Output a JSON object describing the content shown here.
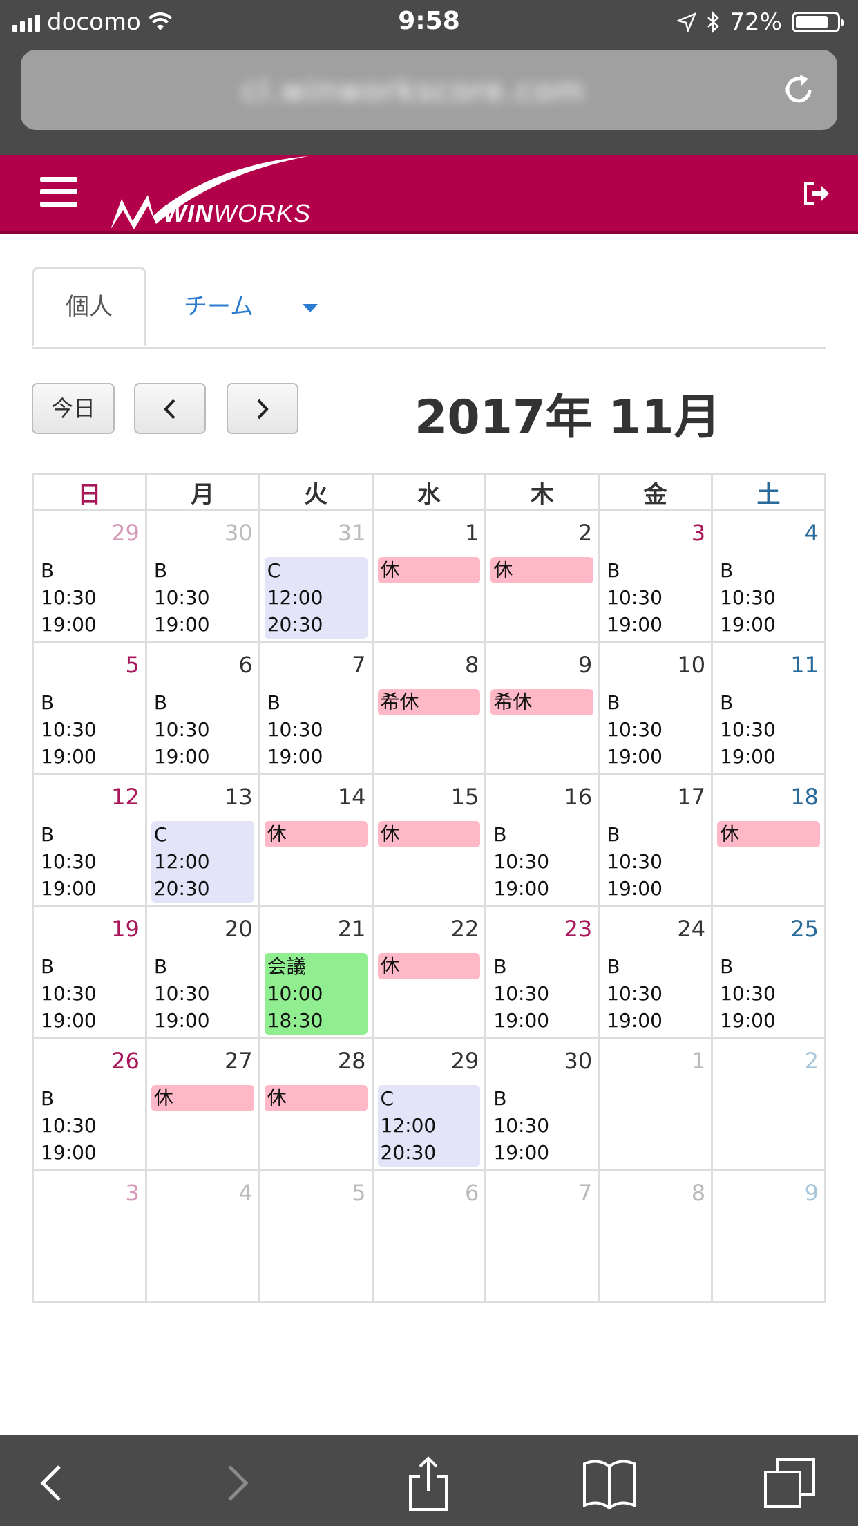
{
  "status": {
    "carrier": "docomo",
    "time": "9:58",
    "battery": "72%"
  },
  "url": {
    "blurred_text": "cl.winworkscore.com"
  },
  "app": {
    "logo_prefix": "WIN",
    "logo_suffix": "WORKS"
  },
  "tabs": {
    "personal": "個人",
    "team": "チーム"
  },
  "nav": {
    "today": "今日",
    "month_title": "2017年 11月"
  },
  "weekdays": [
    "日",
    "月",
    "火",
    "水",
    "木",
    "金",
    "土"
  ],
  "colors": {
    "brand": "#b3004a",
    "sunday": "#a8175a",
    "saturday": "#2a6a9a",
    "rest": "#ffb8c6",
    "shift_c": "#e3e4f8",
    "meeting": "#90ee90"
  },
  "weeks": [
    [
      {
        "day": "29",
        "other": true,
        "event": {
          "type": "plain",
          "l1": "B",
          "l2": "10:30",
          "l3": "19:00"
        }
      },
      {
        "day": "30",
        "other": true,
        "event": {
          "type": "plain",
          "l1": "B",
          "l2": "10:30",
          "l3": "19:00"
        }
      },
      {
        "day": "31",
        "other": true,
        "event": {
          "type": "c",
          "l1": "C",
          "l2": "12:00",
          "l3": "20:30"
        }
      },
      {
        "day": "1",
        "event": {
          "type": "rest",
          "l1": "休",
          "l2": "",
          "l3": ""
        }
      },
      {
        "day": "2",
        "event": {
          "type": "rest",
          "l1": "休",
          "l2": "",
          "l3": ""
        }
      },
      {
        "day": "3",
        "holiday": true,
        "event": {
          "type": "plain",
          "l1": "B",
          "l2": "10:30",
          "l3": "19:00"
        }
      },
      {
        "day": "4",
        "event": {
          "type": "plain",
          "l1": "B",
          "l2": "10:30",
          "l3": "19:00"
        }
      }
    ],
    [
      {
        "day": "5",
        "event": {
          "type": "plain",
          "l1": "B",
          "l2": "10:30",
          "l3": "19:00"
        }
      },
      {
        "day": "6",
        "event": {
          "type": "plain",
          "l1": "B",
          "l2": "10:30",
          "l3": "19:00"
        }
      },
      {
        "day": "7",
        "event": {
          "type": "plain",
          "l1": "B",
          "l2": "10:30",
          "l3": "19:00"
        }
      },
      {
        "day": "8",
        "event": {
          "type": "rest",
          "l1": "希休",
          "l2": "",
          "l3": ""
        }
      },
      {
        "day": "9",
        "event": {
          "type": "rest",
          "l1": "希休",
          "l2": "",
          "l3": ""
        }
      },
      {
        "day": "10",
        "event": {
          "type": "plain",
          "l1": "B",
          "l2": "10:30",
          "l3": "19:00"
        }
      },
      {
        "day": "11",
        "event": {
          "type": "plain",
          "l1": "B",
          "l2": "10:30",
          "l3": "19:00"
        }
      }
    ],
    [
      {
        "day": "12",
        "event": {
          "type": "plain",
          "l1": "B",
          "l2": "10:30",
          "l3": "19:00"
        }
      },
      {
        "day": "13",
        "event": {
          "type": "c",
          "l1": "C",
          "l2": "12:00",
          "l3": "20:30"
        }
      },
      {
        "day": "14",
        "event": {
          "type": "rest",
          "l1": "休",
          "l2": "",
          "l3": ""
        }
      },
      {
        "day": "15",
        "event": {
          "type": "rest",
          "l1": "休",
          "l2": "",
          "l3": ""
        }
      },
      {
        "day": "16",
        "event": {
          "type": "plain",
          "l1": "B",
          "l2": "10:30",
          "l3": "19:00"
        }
      },
      {
        "day": "17",
        "event": {
          "type": "plain",
          "l1": "B",
          "l2": "10:30",
          "l3": "19:00"
        }
      },
      {
        "day": "18",
        "event": {
          "type": "rest",
          "l1": "休",
          "l2": "",
          "l3": ""
        }
      }
    ],
    [
      {
        "day": "19",
        "event": {
          "type": "plain",
          "l1": "B",
          "l2": "10:30",
          "l3": "19:00"
        }
      },
      {
        "day": "20",
        "event": {
          "type": "plain",
          "l1": "B",
          "l2": "10:30",
          "l3": "19:00"
        }
      },
      {
        "day": "21",
        "event": {
          "type": "green",
          "l1": "会議",
          "l2": "10:00",
          "l3": "18:30"
        }
      },
      {
        "day": "22",
        "event": {
          "type": "rest",
          "l1": "休",
          "l2": "",
          "l3": ""
        }
      },
      {
        "day": "23",
        "holiday": true,
        "event": {
          "type": "plain",
          "l1": "B",
          "l2": "10:30",
          "l3": "19:00"
        }
      },
      {
        "day": "24",
        "event": {
          "type": "plain",
          "l1": "B",
          "l2": "10:30",
          "l3": "19:00"
        }
      },
      {
        "day": "25",
        "event": {
          "type": "plain",
          "l1": "B",
          "l2": "10:30",
          "l3": "19:00"
        }
      }
    ],
    [
      {
        "day": "26",
        "event": {
          "type": "plain",
          "l1": "B",
          "l2": "10:30",
          "l3": "19:00"
        }
      },
      {
        "day": "27",
        "event": {
          "type": "rest",
          "l1": "休",
          "l2": "",
          "l3": ""
        }
      },
      {
        "day": "28",
        "event": {
          "type": "rest",
          "l1": "休",
          "l2": "",
          "l3": ""
        }
      },
      {
        "day": "29",
        "event": {
          "type": "c",
          "l1": "C",
          "l2": "12:00",
          "l3": "20:30"
        }
      },
      {
        "day": "30",
        "event": {
          "type": "plain",
          "l1": "B",
          "l2": "10:30",
          "l3": "19:00"
        }
      },
      {
        "day": "1",
        "other": true
      },
      {
        "day": "2",
        "other": true
      }
    ],
    [
      {
        "day": "3",
        "other": true
      },
      {
        "day": "4",
        "other": true
      },
      {
        "day": "5",
        "other": true
      },
      {
        "day": "6",
        "other": true
      },
      {
        "day": "7",
        "other": true
      },
      {
        "day": "8",
        "other": true
      },
      {
        "day": "9",
        "other": true
      }
    ]
  ]
}
